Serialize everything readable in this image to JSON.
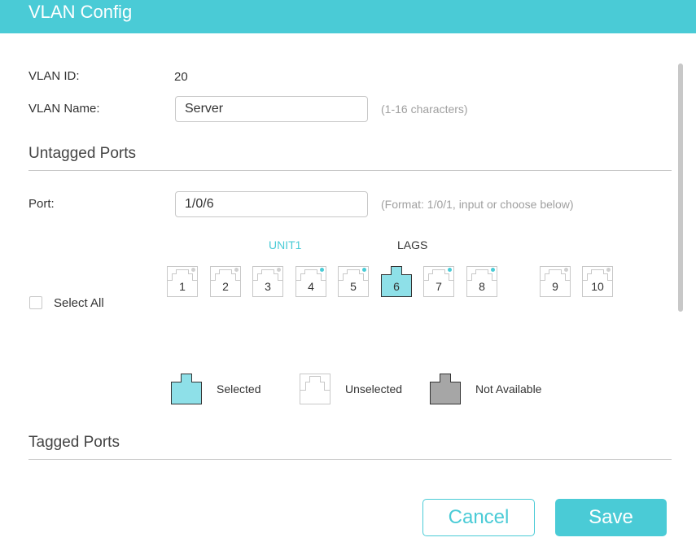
{
  "dialog": {
    "title": "VLAN Config"
  },
  "vlan_id": {
    "label": "VLAN ID:",
    "value": "20"
  },
  "vlan_name": {
    "label": "VLAN Name:",
    "value": "Server",
    "hint": "(1-16 characters)"
  },
  "untagged": {
    "title": "Untagged Ports",
    "port_label": "Port:",
    "port_value": "1/0/6",
    "port_hint": "(Format: 1/0/1, input or choose below)",
    "unit_label": "UNIT1",
    "lags_label": "LAGS",
    "select_all_label": "Select All",
    "select_all_checked": false,
    "ports": [
      {
        "number": "1",
        "state": "unselected",
        "dot": "gray"
      },
      {
        "number": "2",
        "state": "unselected",
        "dot": "gray"
      },
      {
        "number": "3",
        "state": "unselected",
        "dot": "gray"
      },
      {
        "number": "4",
        "state": "unselected",
        "dot": "cyan"
      },
      {
        "number": "5",
        "state": "unselected",
        "dot": "cyan"
      },
      {
        "number": "6",
        "state": "selected",
        "dot": "none"
      },
      {
        "number": "7",
        "state": "unselected",
        "dot": "cyan"
      },
      {
        "number": "8",
        "state": "unselected",
        "dot": "cyan"
      },
      {
        "number": "9",
        "state": "unselected",
        "dot": "gray"
      },
      {
        "number": "10",
        "state": "unselected",
        "dot": "gray"
      }
    ]
  },
  "legend": {
    "selected": "Selected",
    "unselected": "Unselected",
    "not_available": "Not Available"
  },
  "tagged": {
    "title": "Tagged Ports"
  },
  "buttons": {
    "cancel": "Cancel",
    "save": "Save"
  },
  "colors": {
    "accent": "#4acbd6",
    "selected_fill": "#8ee0e8",
    "not_available_fill": "#a6a6a6",
    "port_border": "#c8c8c8",
    "dot_gray": "#d0d0d0",
    "dot_cyan": "#4acbd6"
  }
}
